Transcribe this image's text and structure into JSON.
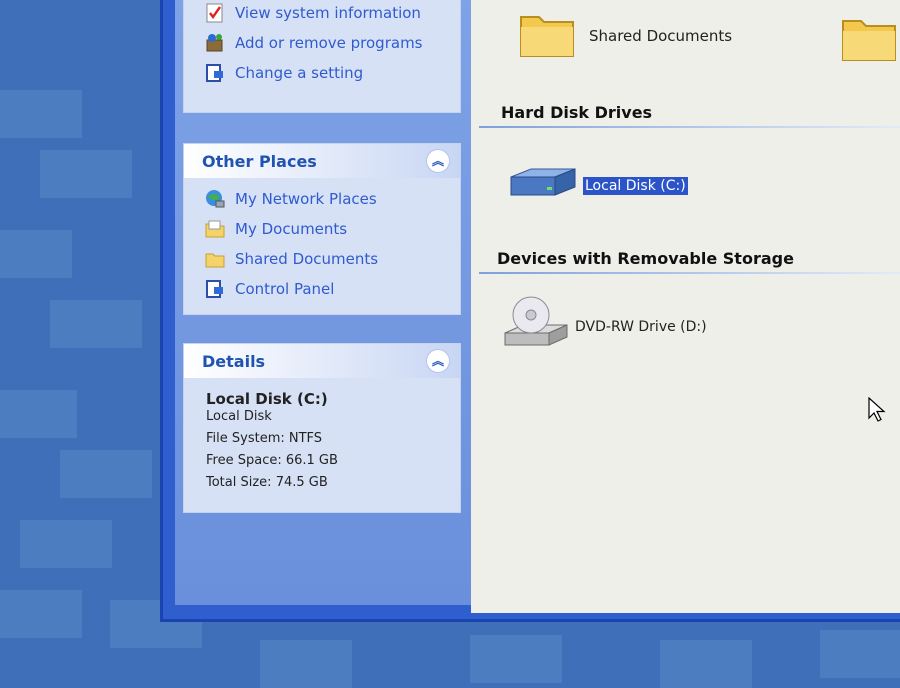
{
  "system_tasks": {
    "items": [
      {
        "label": "View system information",
        "icon": "system-info-icon"
      },
      {
        "label": "Add or remove programs",
        "icon": "add-remove-icon"
      },
      {
        "label": "Change a setting",
        "icon": "control-panel-icon"
      }
    ]
  },
  "other_places": {
    "title": "Other Places",
    "items": [
      {
        "label": "My Network Places",
        "icon": "network-places-icon"
      },
      {
        "label": "My Documents",
        "icon": "folder-icon"
      },
      {
        "label": "Shared Documents",
        "icon": "folder-icon"
      },
      {
        "label": "Control Panel",
        "icon": "control-panel-icon"
      }
    ]
  },
  "details": {
    "title": "Details",
    "drive_name": "Local Disk (C:)",
    "drive_type": "Local Disk",
    "file_system": "File System: NTFS",
    "free_space": "Free Space: 66.1 GB",
    "total_size": "Total Size: 74.5 GB"
  },
  "content": {
    "shared_folder_label": "Shared Documents",
    "hard_disk_heading": "Hard Disk Drives",
    "local_disk_label": "Local Disk (C:)",
    "removable_heading": "Devices with Removable Storage",
    "dvd_label": "DVD-RW Drive (D:)"
  },
  "colors": {
    "link": "#2f5bcf",
    "box_title": "#2153b0",
    "selection": "#2b54c8",
    "window_frame": "#2f5fcf"
  }
}
